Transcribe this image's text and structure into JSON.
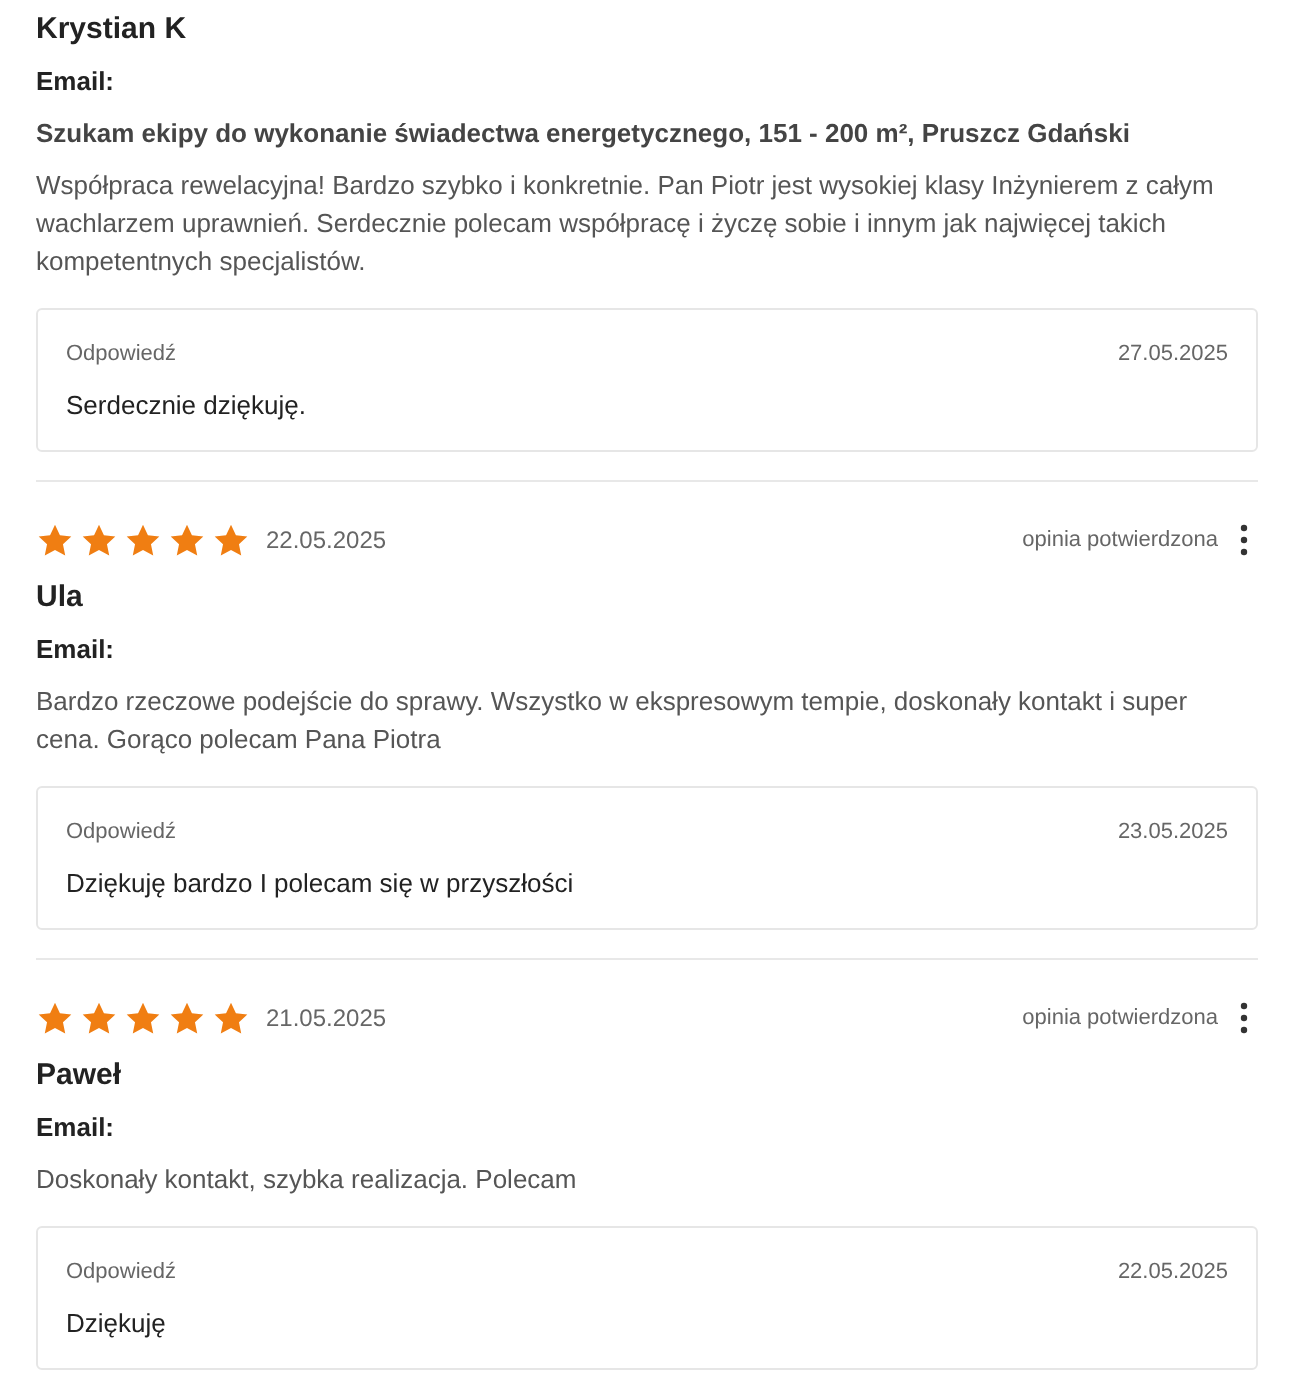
{
  "reviews": [
    {
      "name": "Krystian K",
      "email_label": "Email:",
      "subject": "Szukam ekipy do wykonanie świadectwa energetycznego, 151 - 200 m², Pruszcz Gdański",
      "text": "Współpraca rewelacyjna! Bardzo szybko i konkretnie. Pan Piotr jest wysokiej klasy Inżynierem z całym wachlarzem uprawnień. Serdecznie polecam współpracę i życzę sobie i innym jak najwięcej takich kompetentnych specjalistów.",
      "reply": {
        "label": "Odpowiedź",
        "date": "27.05.2025",
        "text": "Serdecznie dziękuję."
      }
    },
    {
      "stars": 5,
      "date": "22.05.2025",
      "status": "opinia potwierdzona",
      "name": "Ula",
      "email_label": "Email:",
      "text": "Bardzo rzeczowe podejście do sprawy. Wszystko w ekspresowym tempie, doskonały kontakt i super cena. Gorąco polecam Pana Piotra",
      "reply": {
        "label": "Odpowiedź",
        "date": "23.05.2025",
        "text": "Dziękuję bardzo I polecam się w przyszłości"
      }
    },
    {
      "stars": 5,
      "date": "21.05.2025",
      "status": "opinia potwierdzona",
      "name": "Paweł",
      "email_label": "Email:",
      "text": "Doskonały kontakt, szybka realizacja. Polecam",
      "reply": {
        "label": "Odpowiedź",
        "date": "22.05.2025",
        "text": "Dziękuję"
      }
    }
  ]
}
